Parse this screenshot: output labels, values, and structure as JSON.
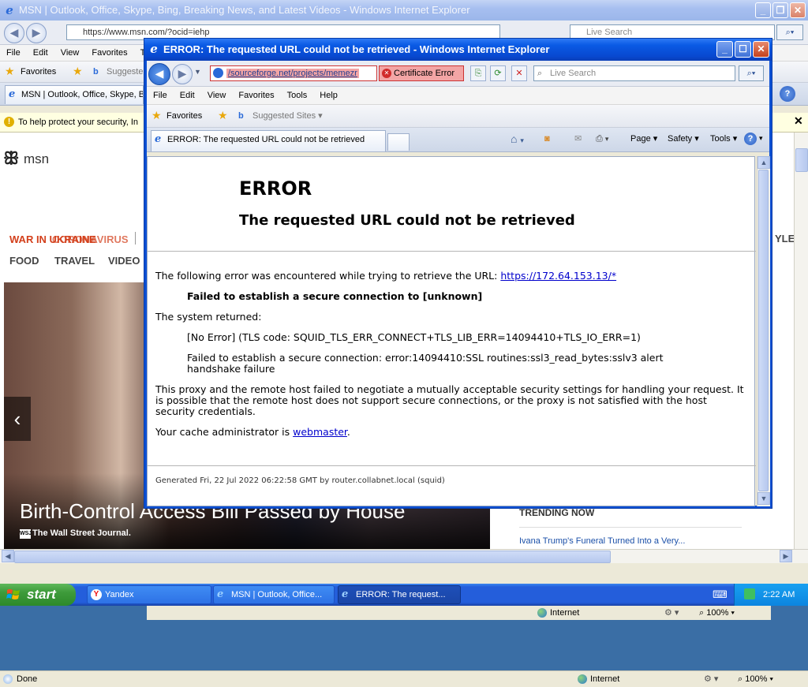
{
  "bg_window": {
    "title": "MSN | Outlook, Office, Skype, Bing, Breaking News, and Latest Videos - Windows Internet Explorer",
    "address": "https://www.msn.com/?ocid=iehp",
    "search_placeholder": "Live Search",
    "menu": [
      "File",
      "Edit",
      "View",
      "Favorites",
      "T"
    ],
    "favorites_label": "Favorites",
    "suggested_label": "Suggeste",
    "tab_label": "MSN | Outlook, Office, Skype, B",
    "infobar_text": "To help protect your security, In",
    "status_text": "Done",
    "zone": "Internet",
    "zoom": "100%"
  },
  "msn": {
    "logo_text": "msn",
    "ticker": "WAR IN UKRAINE",
    "ticker_overlay": "CORONAVIRUS",
    "nav": [
      "FOOD",
      "TRAVEL",
      "VIDEO"
    ],
    "nav_right": "YLE",
    "headline": "Birth-Control Access Bill Passed by House",
    "source": "The Wall Street Journal.",
    "source_badge": "WSJ",
    "trending_title": "TRENDING NOW",
    "trending_item": "Ivana Trump's Funeral Turned Into a Very..."
  },
  "fg_window": {
    "title": "ERROR: The requested URL could not be retrieved - Windows Internet Explorer",
    "address": "/sourceforge.net/projects/memezr",
    "cert_error": "Certificate Error",
    "search_placeholder": "Live Search",
    "menu": [
      "File",
      "Edit",
      "View",
      "Favorites",
      "Tools",
      "Help"
    ],
    "favorites_label": "Favorites",
    "suggested_label": "Suggested Sites",
    "tab_label": "ERROR: The requested URL could not be retrieved",
    "cmd": {
      "page": "Page",
      "safety": "Safety",
      "tools": "Tools"
    },
    "zone": "Internet",
    "zoom": "100%"
  },
  "error_page": {
    "heading": "ERROR",
    "subheading": "The requested URL could not be retrieved",
    "intro": "The following error was encountered while trying to retrieve the URL:",
    "url": "https://172.64.153.13/*",
    "failure": "Failed to establish a secure connection to [unknown]",
    "system_returned": "The system returned:",
    "tls_code": "[No Error] (TLS code: SQUID_TLS_ERR_CONNECT+TLS_LIB_ERR=14094410+TLS_IO_ERR=1)",
    "ssl_error_line1": "Failed to establish a secure connection: error:14094410:SSL routines:ssl3_read_bytes:sslv3 alert",
    "ssl_error_line2": "handshake failure",
    "proxy_line1": "This proxy and the remote host failed to negotiate a mutually acceptable security settings for handling your request. It",
    "proxy_line2": "is possible that the remote host does not support secure connections, or the proxy is not satisfied with the host",
    "proxy_line3": "security credentials.",
    "cache_admin": "Your cache administrator is",
    "admin_link": "webmaster",
    "admin_suffix": ".",
    "footer": "Generated Fri, 22 Jul 2022 06:22:58 GMT by router.collabnet.local (squid)"
  },
  "taskbar": {
    "start": "start",
    "tasks": [
      "Yandex",
      "MSN | Outlook, Office...",
      "ERROR: The request..."
    ],
    "clock": "2:22 AM"
  },
  "colors": {
    "xp_blue": "#0b4fd3",
    "start_green": "#3d9a3a",
    "msn_red": "#d3401c",
    "link_blue": "#0000cc",
    "cert_error_bg": "#f3a5a5"
  }
}
